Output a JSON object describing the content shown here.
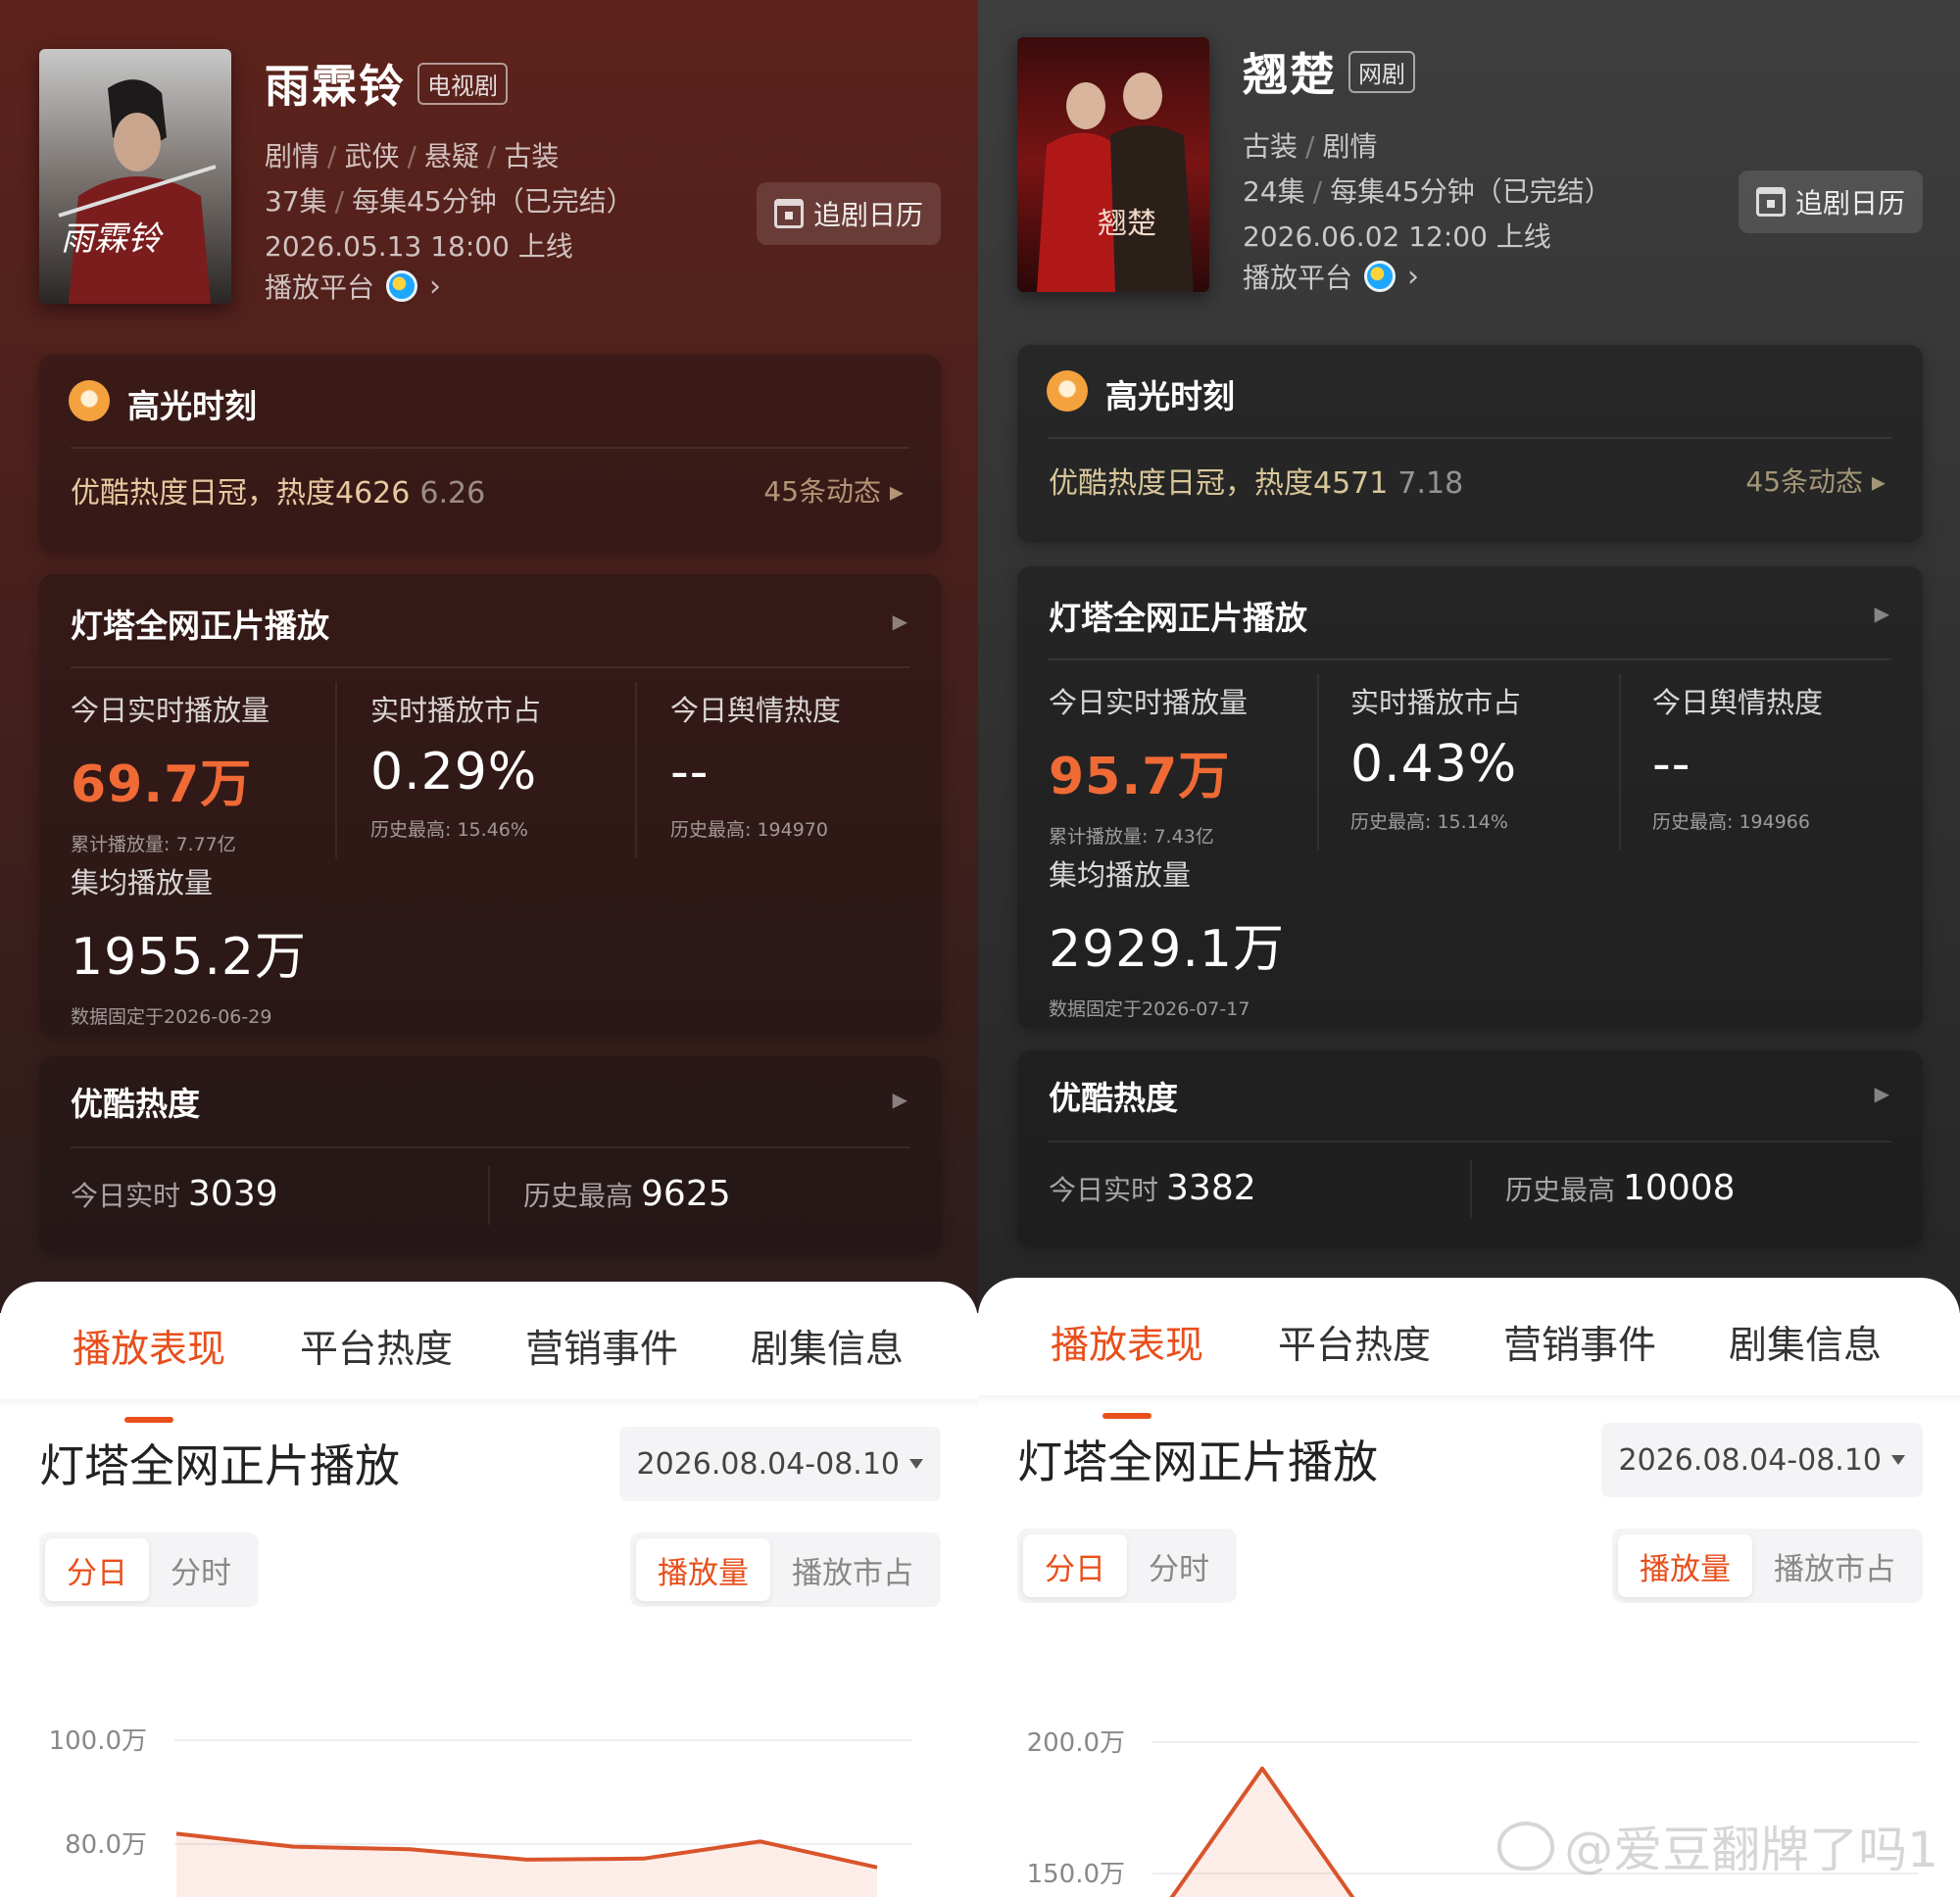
{
  "left": {
    "title": "雨霖铃",
    "type_tag": "电视剧",
    "genres": [
      "剧情",
      "武侠",
      "悬疑",
      "古装"
    ],
    "episodes": "37集",
    "episode_info": "每集45分钟（已完结）",
    "release": "2026.05.13 18:00 上线",
    "platform_label": "播放平台",
    "calendar_button": "追剧日历",
    "poster_text": "雨霖铃",
    "highlight": {
      "title": "高光时刻",
      "text": "优酷热度日冠，热度4626",
      "date": "6.26",
      "count": "45条动态"
    },
    "plays": {
      "title": "灯塔全网正片播放",
      "stats": [
        {
          "label": "今日实时播放量",
          "value": "69.7万",
          "sub": "累计播放量: 7.77亿"
        },
        {
          "label": "实时播放市占",
          "value": "0.29%",
          "sub": "历史最高: 15.46%"
        },
        {
          "label": "今日舆情热度",
          "value": "--",
          "sub": "历史最高: 194970"
        }
      ],
      "avg_label": "集均播放量",
      "avg_value": "1955.2万",
      "avg_note": "数据固定于2026-06-29"
    },
    "youku_heat": {
      "title": "优酷热度",
      "today_label": "今日实时",
      "today_value": "3039",
      "max_label": "历史最高",
      "max_value": "9625"
    },
    "tabs": [
      "播放表现",
      "平台热度",
      "营销事件",
      "剧集信息"
    ],
    "section_title": "灯塔全网正片播放",
    "date_range": "2026.08.04-08.10",
    "seg_time": [
      "分日",
      "分时"
    ],
    "seg_metric": [
      "播放量",
      "播放市占"
    ],
    "chart_data": {
      "type": "area",
      "y_ticks": [
        "100.0万",
        "80.0万"
      ],
      "y_tick_values": [
        100,
        80
      ],
      "unit": "万",
      "values": [
        82,
        79.5,
        79,
        77,
        77.2,
        80.5,
        75.5
      ]
    }
  },
  "right": {
    "title": "翘楚",
    "type_tag": "网剧",
    "genres": [
      "古装",
      "剧情"
    ],
    "episodes": "24集",
    "episode_info": "每集45分钟（已完结）",
    "release": "2026.06.02 12:00 上线",
    "platform_label": "播放平台",
    "calendar_button": "追剧日历",
    "poster_text": "翘楚",
    "highlight": {
      "title": "高光时刻",
      "text": "优酷热度日冠，热度4571",
      "date": "7.18",
      "count": "45条动态"
    },
    "plays": {
      "title": "灯塔全网正片播放",
      "stats": [
        {
          "label": "今日实时播放量",
          "value": "95.7万",
          "sub": "累计播放量: 7.43亿"
        },
        {
          "label": "实时播放市占",
          "value": "0.43%",
          "sub": "历史最高: 15.14%"
        },
        {
          "label": "今日舆情热度",
          "value": "--",
          "sub": "历史最高: 194966"
        }
      ],
      "avg_label": "集均播放量",
      "avg_value": "2929.1万",
      "avg_note": "数据固定于2026-07-17"
    },
    "youku_heat": {
      "title": "优酷热度",
      "today_label": "今日实时",
      "today_value": "3382",
      "max_label": "历史最高",
      "max_value": "10008"
    },
    "tabs": [
      "播放表现",
      "平台热度",
      "营销事件",
      "剧集信息"
    ],
    "section_title": "灯塔全网正片播放",
    "date_range": "2026.08.04-08.10",
    "seg_time": [
      "分日",
      "分时"
    ],
    "seg_metric": [
      "播放量",
      "播放市占"
    ],
    "chart_data": {
      "type": "area",
      "y_ticks": [
        "200.0万",
        "150.0万"
      ],
      "y_tick_values": [
        200,
        150
      ],
      "unit": "万",
      "values": [
        140,
        190,
        140
      ]
    }
  },
  "watermark": "@爱豆翻牌了吗1"
}
